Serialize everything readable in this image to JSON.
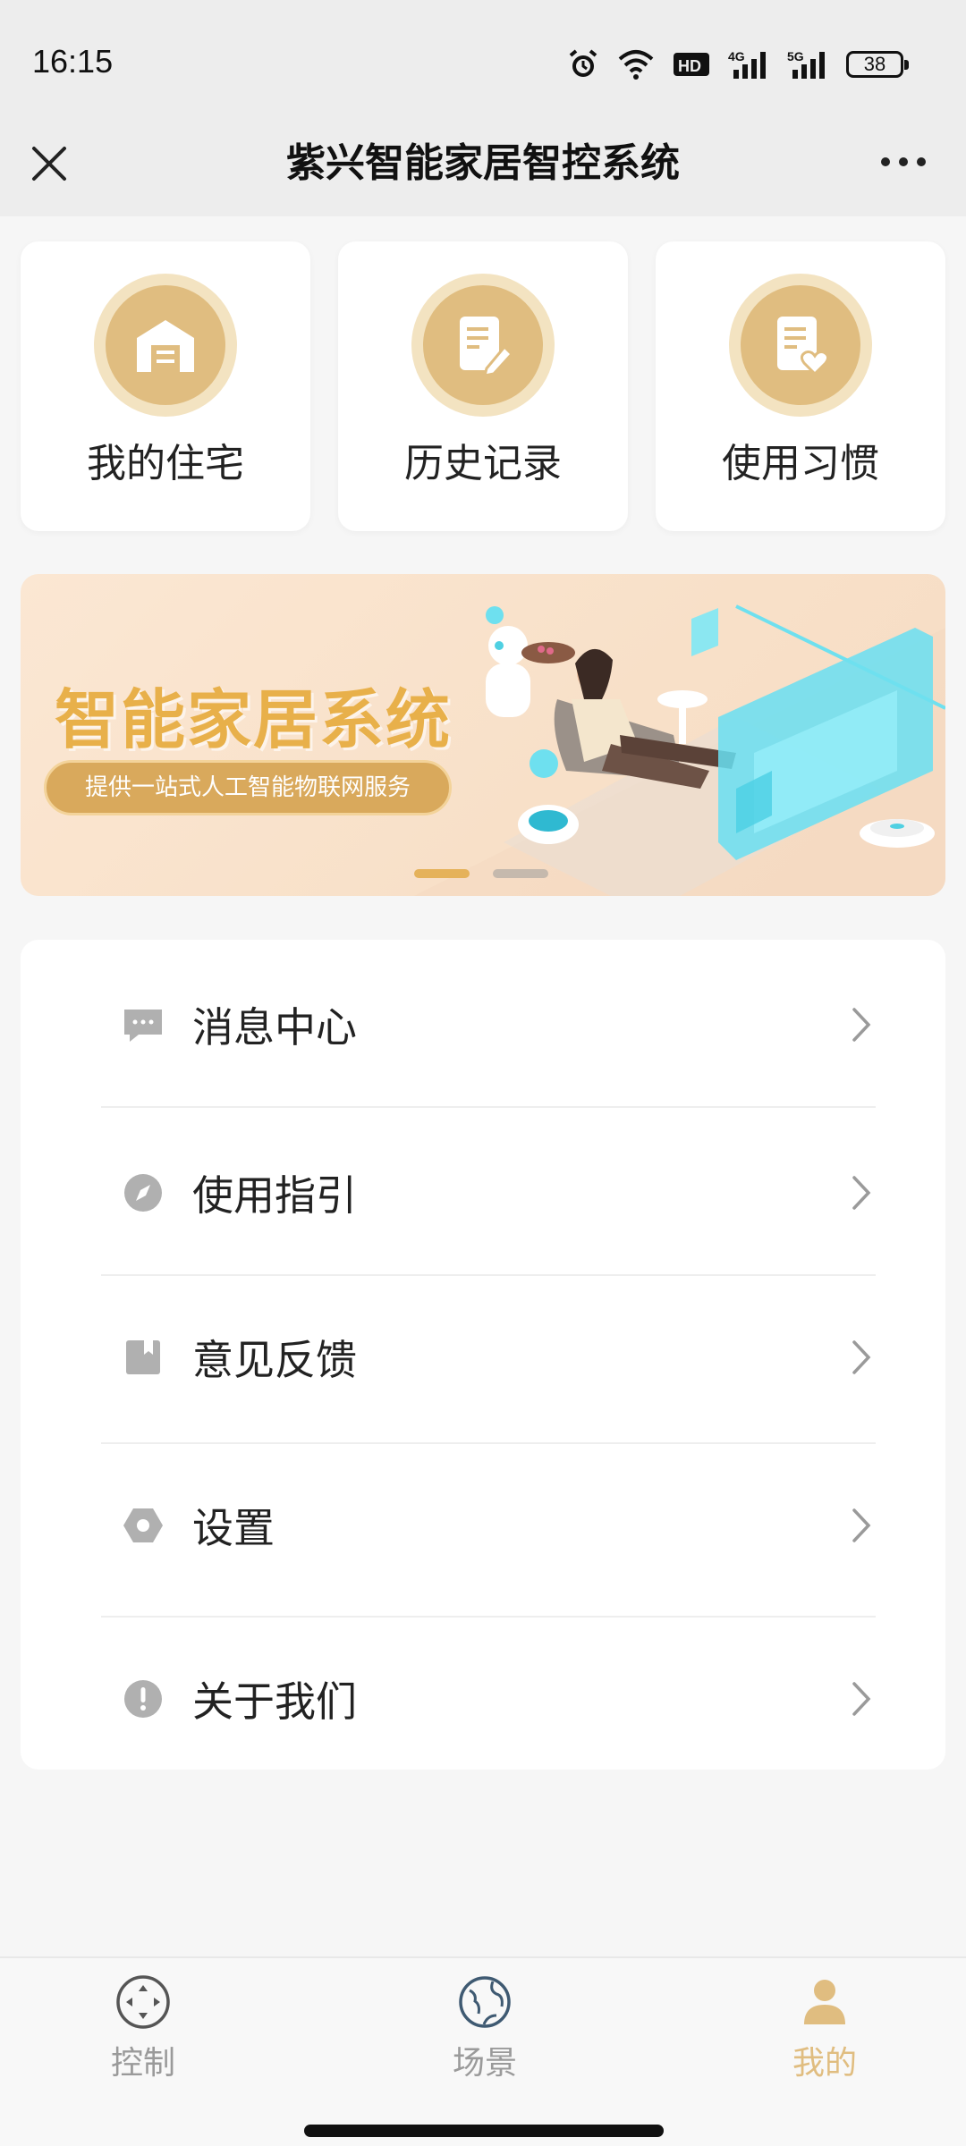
{
  "status": {
    "time": "16:15",
    "battery": "38"
  },
  "nav": {
    "title": "紫兴智能家居智控系统"
  },
  "quick": [
    {
      "label": "我的住宅",
      "icon": "warehouse-icon"
    },
    {
      "label": "历史记录",
      "icon": "document-edit-icon"
    },
    {
      "label": "使用习惯",
      "icon": "document-heart-icon"
    }
  ],
  "banner": {
    "title": "智能家居系统",
    "subtitle": "提供一站式人工智能物联网服务",
    "dots": 2,
    "active_dot": 1
  },
  "menu": [
    {
      "label": "消息中心",
      "icon": "chat-bubble-icon"
    },
    {
      "label": "使用指引",
      "icon": "compass-icon"
    },
    {
      "label": "意见反馈",
      "icon": "bookmark-icon"
    },
    {
      "label": "设置",
      "icon": "hexagon-settings-icon"
    },
    {
      "label": "关于我们",
      "icon": "info-circle-icon"
    }
  ],
  "tabs": [
    {
      "label": "控制",
      "icon": "control-pad-icon",
      "active": false
    },
    {
      "label": "场景",
      "icon": "globe-icon",
      "active": false
    },
    {
      "label": "我的",
      "icon": "person-icon",
      "active": true
    }
  ],
  "colors": {
    "accent": "#e0bd80",
    "accent_light": "#f3e3c1",
    "banner_bg": "#fbe7d3",
    "text": "#222222",
    "icon_gray": "#b0b0b0"
  }
}
